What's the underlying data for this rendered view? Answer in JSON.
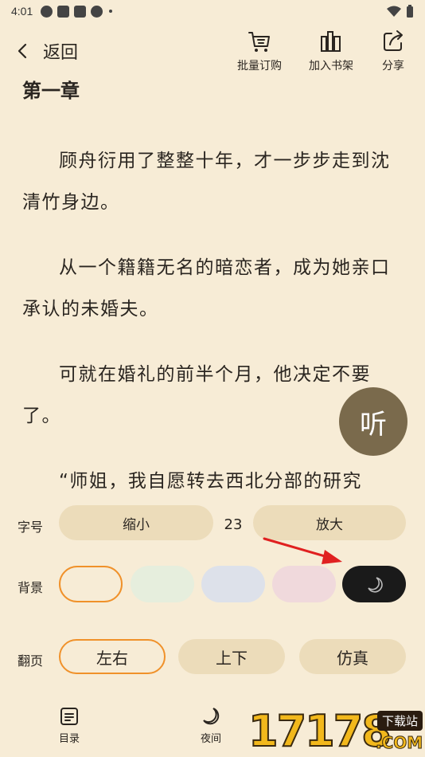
{
  "status_bar": {
    "time": "4:01"
  },
  "header": {
    "back_label": "返回",
    "actions": [
      {
        "label": "批量订购",
        "icon": "cart-icon"
      },
      {
        "label": "加入书架",
        "icon": "bookshelf-icon"
      },
      {
        "label": "分享",
        "icon": "share-icon"
      }
    ]
  },
  "reader": {
    "chapter_title": "第一章",
    "paragraphs": [
      "顾舟衍用了整整十年，才一步步走到沈清竹身边。",
      "从一个籍籍无名的暗恋者，成为她亲口承认的未婚夫。",
      "可就在婚礼的前半个月，他决定不要了。",
      "“师姐，我自愿转去西北分部的研究"
    ],
    "listen_label": "听"
  },
  "settings": {
    "font_size": {
      "label": "字号",
      "decrease": "缩小",
      "value": "23",
      "increase": "放大"
    },
    "background": {
      "label": "背景",
      "options": [
        "#f7ecd6",
        "#e6eedd",
        "#dde1ea",
        "#f0d9dc",
        "#1a1a1a"
      ],
      "selected_index": 0
    },
    "page_turn": {
      "label": "翻页",
      "options": [
        "左右",
        "上下",
        "仿真"
      ],
      "selected_index": 0
    }
  },
  "bottom_nav": [
    {
      "label": "目录",
      "icon": "catalog-icon"
    },
    {
      "label": "夜间",
      "icon": "moon-icon"
    }
  ],
  "watermark": {
    "digits": "17178",
    "badge": "下载站",
    "domain": ".COM"
  },
  "colors": {
    "accent": "#f0912a",
    "listen_bg": "#7a6a4c",
    "pill_bg": "#ecdcba",
    "page_bg": "#f7ecd6"
  }
}
